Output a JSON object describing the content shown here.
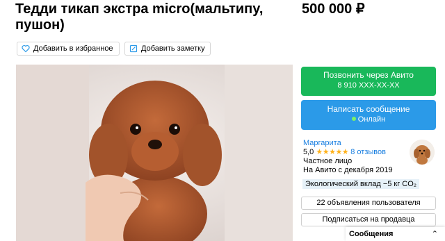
{
  "listing": {
    "title": "Тедди тикап экстра micro(мальтипу, пушон)",
    "price": "500 000 ₽"
  },
  "actions": {
    "favorite_label": "Добавить в избранное",
    "note_label": "Добавить заметку"
  },
  "contact": {
    "call_label": "Позвонить через Авито",
    "phone": "8 910 XXX-XX-XX",
    "message_label": "Написать сообщение",
    "online_label": "Онлайн"
  },
  "seller": {
    "name": "Маргарита",
    "rating": "5,0",
    "stars": "★★★★★",
    "reviews": "8 отзывов",
    "type": "Частное лицо",
    "since": "На Авито с декабря 2019",
    "eco": "Экологический вклад −5 кг CO₂"
  },
  "links": {
    "user_ads": "22 объявления пользователя",
    "subscribe": "Подписаться на продавца"
  },
  "messages": {
    "label": "Сообщения",
    "chevron": "⌃"
  },
  "colors": {
    "call_green": "#19b85a",
    "message_blue": "#2b9ae8",
    "link_blue": "#1a7fe0",
    "star_yellow": "#ffb21a"
  }
}
